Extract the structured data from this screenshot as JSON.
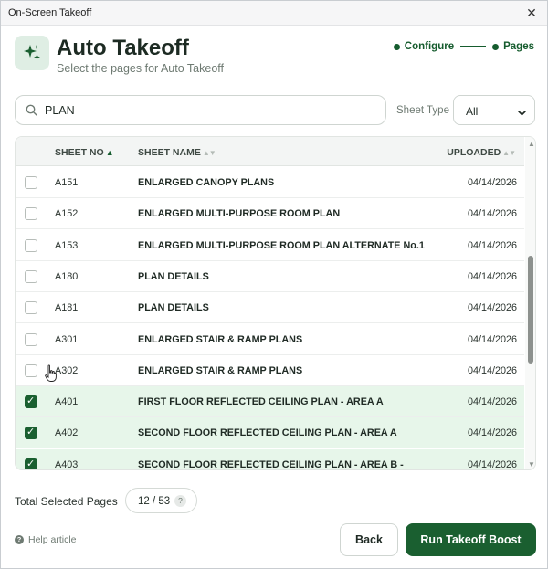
{
  "window": {
    "title": "On-Screen Takeoff",
    "close_glyph": "✕"
  },
  "header": {
    "icon": "sparkles-icon",
    "title": "Auto Takeoff",
    "subtitle": "Select the pages for Auto Takeoff"
  },
  "steps": [
    {
      "label": "Configure"
    },
    {
      "label": "Pages"
    }
  ],
  "search": {
    "value": "PLAN",
    "placeholder": ""
  },
  "filter": {
    "label": "Sheet Type",
    "selected": "All"
  },
  "table": {
    "columns": {
      "sheet_no": "SHEET NO",
      "sheet_name": "SHEET NAME",
      "uploaded": "UPLOADED"
    },
    "sort_glyphs": {
      "active": "▲",
      "inactive": "▲▼"
    },
    "rows": [
      {
        "no": "A151",
        "name": "ENLARGED CANOPY PLANS",
        "uploaded": "04/14/2026",
        "selected": false
      },
      {
        "no": "A152",
        "name": "ENLARGED MULTI-PURPOSE ROOM PLAN",
        "uploaded": "04/14/2026",
        "selected": false
      },
      {
        "no": "A153",
        "name": "ENLARGED MULTI-PURPOSE ROOM PLAN ALTERNATE No.1",
        "uploaded": "04/14/2026",
        "selected": false
      },
      {
        "no": "A180",
        "name": "PLAN DETAILS",
        "uploaded": "04/14/2026",
        "selected": false
      },
      {
        "no": "A181",
        "name": "PLAN DETAILS",
        "uploaded": "04/14/2026",
        "selected": false
      },
      {
        "no": "A301",
        "name": "ENLARGED STAIR & RAMP PLANS",
        "uploaded": "04/14/2026",
        "selected": false
      },
      {
        "no": "A302",
        "name": "ENLARGED STAIR & RAMP PLANS",
        "uploaded": "04/14/2026",
        "selected": false
      },
      {
        "no": "A401",
        "name": "FIRST FLOOR REFLECTED CEILING PLAN - AREA A",
        "uploaded": "04/14/2026",
        "selected": true
      },
      {
        "no": "A402",
        "name": "SECOND FLOOR REFLECTED CEILING PLAN - AREA A",
        "uploaded": "04/14/2026",
        "selected": true
      },
      {
        "no": "A403",
        "name": "SECOND FLOOR REFLECTED CEILING PLAN - AREA B -",
        "uploaded": "04/14/2026",
        "selected": true
      }
    ]
  },
  "footer": {
    "total_label": "Total Selected Pages",
    "total_value": "12 / 53",
    "total_help": "?",
    "help_glyph": "?",
    "help_label": "Help article",
    "back_label": "Back",
    "run_label": "Run Takeoff Boost"
  },
  "colors": {
    "accent": "#1a5f30",
    "selected_row": "#e7f6ea"
  }
}
